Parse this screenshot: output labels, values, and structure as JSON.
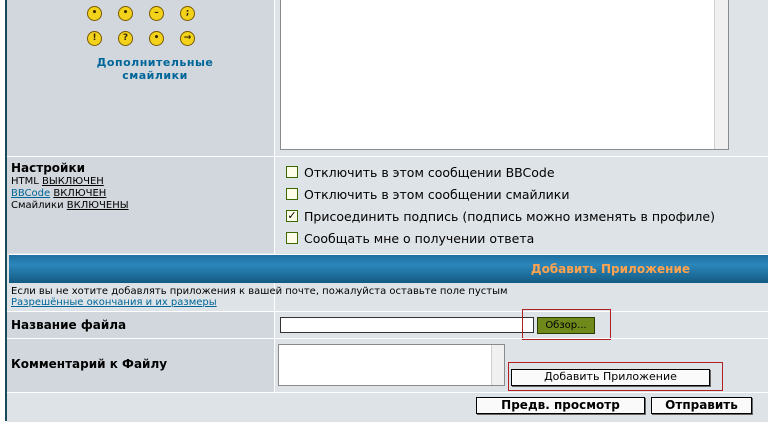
{
  "smilies": {
    "row1": [
      {
        "icon": "evil-icon",
        "glyph": "•"
      },
      {
        "icon": "twisted-icon",
        "glyph": "•"
      },
      {
        "icon": "neutral-icon",
        "glyph": "–"
      },
      {
        "icon": "wink-icon",
        "glyph": ";"
      }
    ],
    "row2": [
      {
        "icon": "exclaim-icon",
        "glyph": "!"
      },
      {
        "icon": "question-icon",
        "glyph": "?"
      },
      {
        "icon": "idea-icon",
        "glyph": "•"
      },
      {
        "icon": "arrow-icon",
        "glyph": "→"
      }
    ],
    "more_label_line1": "Дополнительные",
    "more_label_line2": "смайлики"
  },
  "settings": {
    "title": "Настройки",
    "html_label": "HTML",
    "html_state": "ВЫКЛЮЧЕН",
    "bbcode_label": "BBCode",
    "bbcode_state": "ВКЛЮЧЕН",
    "smilies_label": "Смайлики",
    "smilies_state": "ВКЛЮЧЕНЫ",
    "options": [
      {
        "label": "Отключить в этом сообщении BBCode",
        "checked": false
      },
      {
        "label": "Отключить в этом сообщении смайлики",
        "checked": false
      },
      {
        "label": "Присоединить подпись (подпись можно изменять в профиле)",
        "checked": true
      },
      {
        "label": "Сообщать мне о получении ответа",
        "checked": false
      }
    ]
  },
  "attachment": {
    "header": "Добавить Приложение",
    "note": "Если вы не хотите добавлять приложения к вашей почте, пожалуйста оставьте поле пустым",
    "extensions_link": "Разрешённые окончания и их размеры",
    "filename_label": "Название файла",
    "file_value": "",
    "browse_label": "Обзор...",
    "comment_label": "Комментарий к Файлу",
    "comment_value": "",
    "add_button": "Добавить Приложение"
  },
  "actions": {
    "preview": "Предв. просмотр",
    "submit": "Отправить"
  },
  "colors": {
    "accent_header_text": "#ffa34f",
    "link": "#006699",
    "header_bar": "#1e6f9f"
  }
}
